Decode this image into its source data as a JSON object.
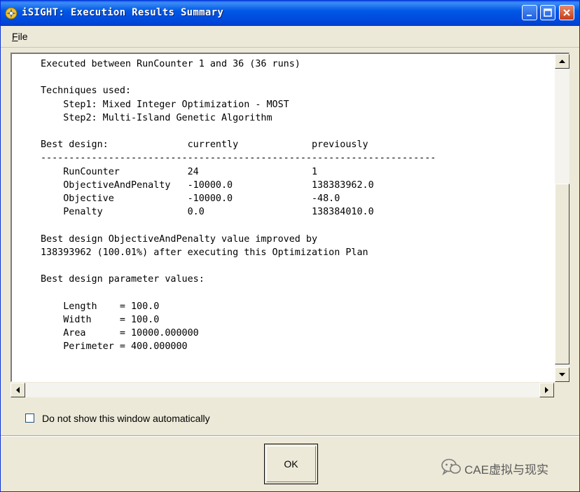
{
  "window": {
    "title": "iSIGHT: Execution Results Summary"
  },
  "menu": {
    "file_label": "File",
    "file_mnemonic": "F",
    "file_rest": "ile"
  },
  "results": {
    "lines": [
      "Executed between RunCounter 1 and 36 (36 runs)",
      "",
      "Techniques used:",
      "    Step1: Mixed Integer Optimization - MOST",
      "    Step2: Multi-Island Genetic Algorithm",
      "",
      "Best design:              currently             previously",
      "----------------------------------------------------------------------",
      "    RunCounter            24                    1",
      "    ObjectiveAndPenalty   -10000.0              138383962.0",
      "    Objective             -10000.0              -48.0",
      "    Penalty               0.0                   138384010.0",
      "",
      "Best design ObjectiveAndPenalty value improved by",
      "138393962 (100.01%) after executing this Optimization Plan",
      "",
      "Best design parameter values:",
      "",
      "    Length    = 100.0",
      "    Width     = 100.0",
      "    Area      = 10000.000000",
      "    Perimeter = 400.000000"
    ]
  },
  "checkbox": {
    "label": "Do not show this window automatically",
    "checked": false
  },
  "ok_button": {
    "label": "OK"
  },
  "watermark": {
    "text": "CAE虚拟与现实"
  },
  "colors": {
    "titlebar": "#0058e6",
    "window_bg": "#ece9d8",
    "close_button": "#c63c17"
  }
}
